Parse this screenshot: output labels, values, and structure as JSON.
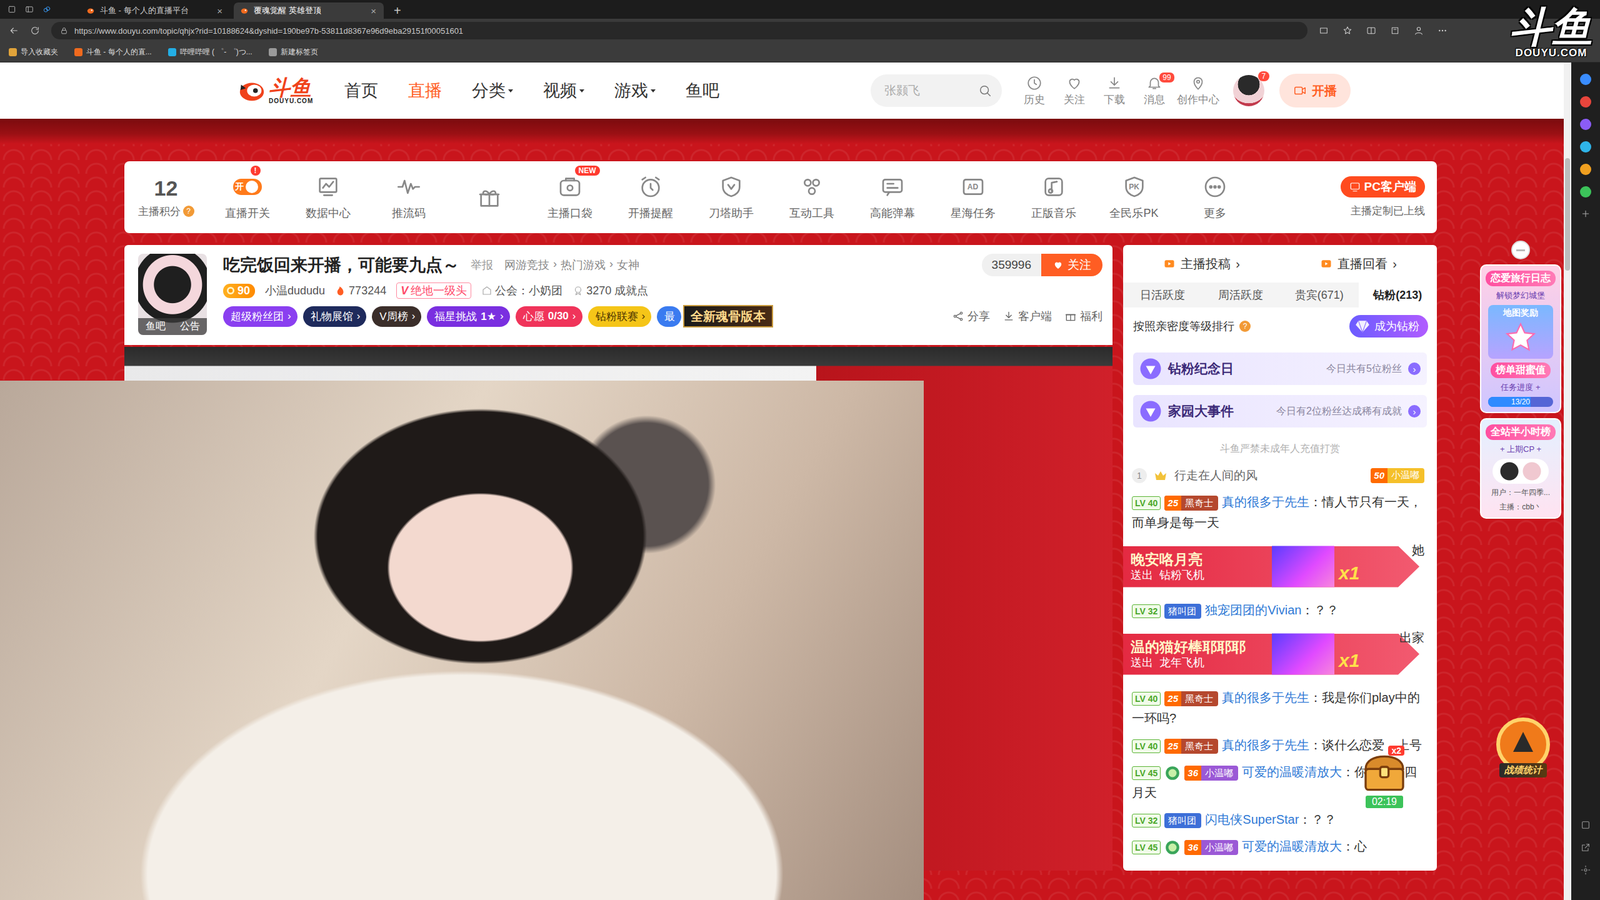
{
  "browser": {
    "tabs": [
      {
        "label": "斗鱼 - 每个人的直播平台",
        "close": "×",
        "selected": false
      },
      {
        "label": "覆魂觉醒 英雄登顶",
        "close": "×",
        "selected": true
      }
    ],
    "new_tab": "+",
    "url": "https://www.douyu.com/topic/qhjx?rid=10188624&dyshid=190be97b-53811d8367e96d9eba29151f00051601",
    "bookmarks": [
      {
        "label": "导入收藏夹",
        "color": "#e0a33a"
      },
      {
        "label": "斗鱼 - 每个人的直...",
        "color": "#f06a1e"
      },
      {
        "label": "哔哩哔哩 ( ゜- ゜)つ...",
        "color": "#23aee5"
      },
      {
        "label": "新建标签页",
        "color": "#9a9a9a"
      }
    ]
  },
  "watermark": {
    "logo": "斗鱼",
    "domain": "DOUYU.COM"
  },
  "header": {
    "logo": "斗鱼",
    "logo_domain": "DOUYU.COM",
    "nav": [
      {
        "label": "首页",
        "selected": false,
        "dropdown": false
      },
      {
        "label": "直播",
        "selected": true,
        "dropdown": false
      },
      {
        "label": "分类",
        "selected": false,
        "dropdown": true
      },
      {
        "label": "视频",
        "selected": false,
        "dropdown": true
      },
      {
        "label": "游戏",
        "selected": false,
        "dropdown": true
      },
      {
        "label": "鱼吧",
        "selected": false,
        "dropdown": false
      }
    ],
    "search": {
      "placeholder": "张颢飞"
    },
    "icons": [
      {
        "label": "历史",
        "kind": "clock"
      },
      {
        "label": "关注",
        "kind": "heart"
      },
      {
        "label": "下载",
        "kind": "download"
      },
      {
        "label": "消息",
        "kind": "bell",
        "badge": "99"
      },
      {
        "label": "创作中心",
        "kind": "pin"
      }
    ],
    "avatar_badge": "7",
    "live_button": "开播"
  },
  "tools": {
    "score": "12",
    "score_label": "主播积分",
    "score_help": "?",
    "items": [
      {
        "label": "直播开关",
        "kind": "toggle",
        "toggle_text": "开",
        "on": true,
        "badge": "!"
      },
      {
        "label": "数据中心",
        "kind": "chart"
      },
      {
        "label": "推流码",
        "kind": "wave"
      },
      {
        "kind": "gift"
      },
      {
        "label": "主播口袋",
        "kind": "pocket",
        "badge": "NEW"
      },
      {
        "label": "开播提醒",
        "kind": "alarm"
      },
      {
        "label": "刀塔助手",
        "kind": "shield"
      },
      {
        "label": "互动工具",
        "kind": "interact"
      },
      {
        "label": "高能弹幕",
        "kind": "barrage"
      },
      {
        "label": "星海任务",
        "kind": "ad",
        "icon_text": "AD"
      },
      {
        "label": "正版音乐",
        "kind": "music"
      },
      {
        "label": "全民乐PK",
        "kind": "pk",
        "icon_text": "PK"
      },
      {
        "label": "更多",
        "kind": "more"
      }
    ],
    "pc_button": "PC客户端",
    "pc_note": "主播定制已上线"
  },
  "room": {
    "avatar_tabs": [
      "鱼吧",
      "公告"
    ],
    "title": "吃完饭回来开播，可能要九点～",
    "report": "举报",
    "categories": [
      "网游竞技",
      "热门游戏",
      "女神"
    ],
    "category_sep": "›",
    "followers": "359996",
    "follow": "关注",
    "level": "90",
    "name": "小温dududu",
    "hot": "773244",
    "tag_mark": "V",
    "tag": "绝地一级头",
    "guild": "公会：小奶团",
    "achievement": "3270 成就点",
    "badges": [
      {
        "label": "超级粉丝团",
        "arrow": "›",
        "color": "#8a3ff0"
      },
      {
        "label": "礼物展馆",
        "arrow": "›",
        "color": "#1e2a5c"
      },
      {
        "label": "V周榜",
        "arrow": "›",
        "color": "#3b2e2a"
      },
      {
        "label": "福星挑战",
        "extra": "1★",
        "arrow": "›",
        "color": "#7a2fe0"
      },
      {
        "label": "心愿",
        "extra": "0/30",
        "arrow": "›",
        "color": "#f0345a"
      },
      {
        "label": "钻粉联赛",
        "arrow": "›",
        "color": "#f5c518"
      },
      {
        "label": "最",
        "color": "#3a7bf0"
      }
    ],
    "banner": "全新魂骨版本",
    "actions": [
      "分享",
      "客户端",
      "福利"
    ]
  },
  "panel": {
    "links": [
      {
        "label": "主播投稿",
        "arrow": "›"
      },
      {
        "label": "直播回看",
        "arrow": "›"
      }
    ],
    "tabs": [
      {
        "label": "日活跃度",
        "selected": false
      },
      {
        "label": "周活跃度",
        "selected": false
      },
      {
        "label": "贵宾(671)",
        "selected": false
      },
      {
        "label": "钻粉(213)",
        "selected": true
      }
    ],
    "rank_note": "按照亲密度等级排行",
    "rank_help": "?",
    "join": "成为钻粉",
    "events": [
      {
        "title": "钻粉纪念日",
        "text": "今日共有5位粉丝",
        "arrow": "›"
      },
      {
        "title": "家园大事件",
        "text": "今日有2位粉丝达成稀有成就",
        "arrow": "›"
      }
    ],
    "notice": "斗鱼严禁未成年人充值打赏",
    "top_fan": {
      "rank": "1",
      "user": "行走在人间的风",
      "fan_level": "50",
      "fan_club": "小温嘟"
    },
    "chest": {
      "count": "x2",
      "timer": "02:19"
    }
  },
  "chat": [
    {
      "kind": "msg",
      "level": "LV 40",
      "vip": false,
      "badge": {
        "level": "25",
        "name": "黑奇士",
        "color": "#b5482e"
      },
      "user": "真的很多于先生",
      "sep": "：",
      "text": "情人节只有一天，而单身是每一天"
    },
    {
      "kind": "gift",
      "sender": "晚安咯月亮",
      "verb": "送出",
      "gift": "钻粉飞机",
      "count": "x1",
      "peek": "她"
    },
    {
      "kind": "msg",
      "level": "LV 32",
      "vip": false,
      "badge": {
        "name": "猪叫团",
        "color": "#3d6fd8"
      },
      "user": "独宠团团的Vivian",
      "sep": "：",
      "text": "？？"
    },
    {
      "kind": "gift",
      "sender": "温的猫好棒耶耶耶",
      "verb": "送出",
      "gift": "龙年飞机",
      "count": "x1",
      "peek": "出家"
    },
    {
      "kind": "msg",
      "level": "LV 40",
      "vip": false,
      "badge": {
        "level": "25",
        "name": "黑奇士",
        "color": "#b5482e"
      },
      "user": "真的很多于先生",
      "sep": "：",
      "text": "我是你们play中的一环吗?"
    },
    {
      "kind": "msg",
      "level": "LV 40",
      "vip": false,
      "badge": {
        "level": "25",
        "name": "黑奇士",
        "color": "#b5482e"
      },
      "user": "真的很多于先生",
      "sep": "：",
      "text": "谈什么恋爱，上号"
    },
    {
      "kind": "msg",
      "level": "LV 45",
      "vip": true,
      "badge": {
        "level": "36",
        "name": "小温嘟",
        "color": "#9b59d6"
      },
      "user": "可爱的温暖清放大",
      "sep": "：",
      "text": "你是人间四月天"
    },
    {
      "kind": "msg",
      "level": "LV 32",
      "vip": false,
      "badge": {
        "name": "猪叫团",
        "color": "#3d6fd8"
      },
      "user": "闪电侠SuperStar",
      "sep": "：",
      "text": "？？"
    },
    {
      "kind": "msg",
      "level": "LV 45",
      "vip": true,
      "badge": {
        "level": "36",
        "name": "小温嘟",
        "color": "#9b59d6"
      },
      "user": "可爱的温暖清放大",
      "sep": "：",
      "text": "心"
    }
  ],
  "widgets": {
    "love": {
      "title": "恋爱旅行日志",
      "subtitle": "解锁梦幻城堡",
      "reward": "地图奖励",
      "sweet": "榜单甜蜜值",
      "task": "任务进度 +",
      "progress": "13/20",
      "level": 0.65
    },
    "rank": {
      "title": "全站半小时榜",
      "cp": "+ 上期CP +",
      "user": "用户：一年四季...",
      "anchor": "主播：cbb丶"
    },
    "stats": "战绩统计"
  }
}
